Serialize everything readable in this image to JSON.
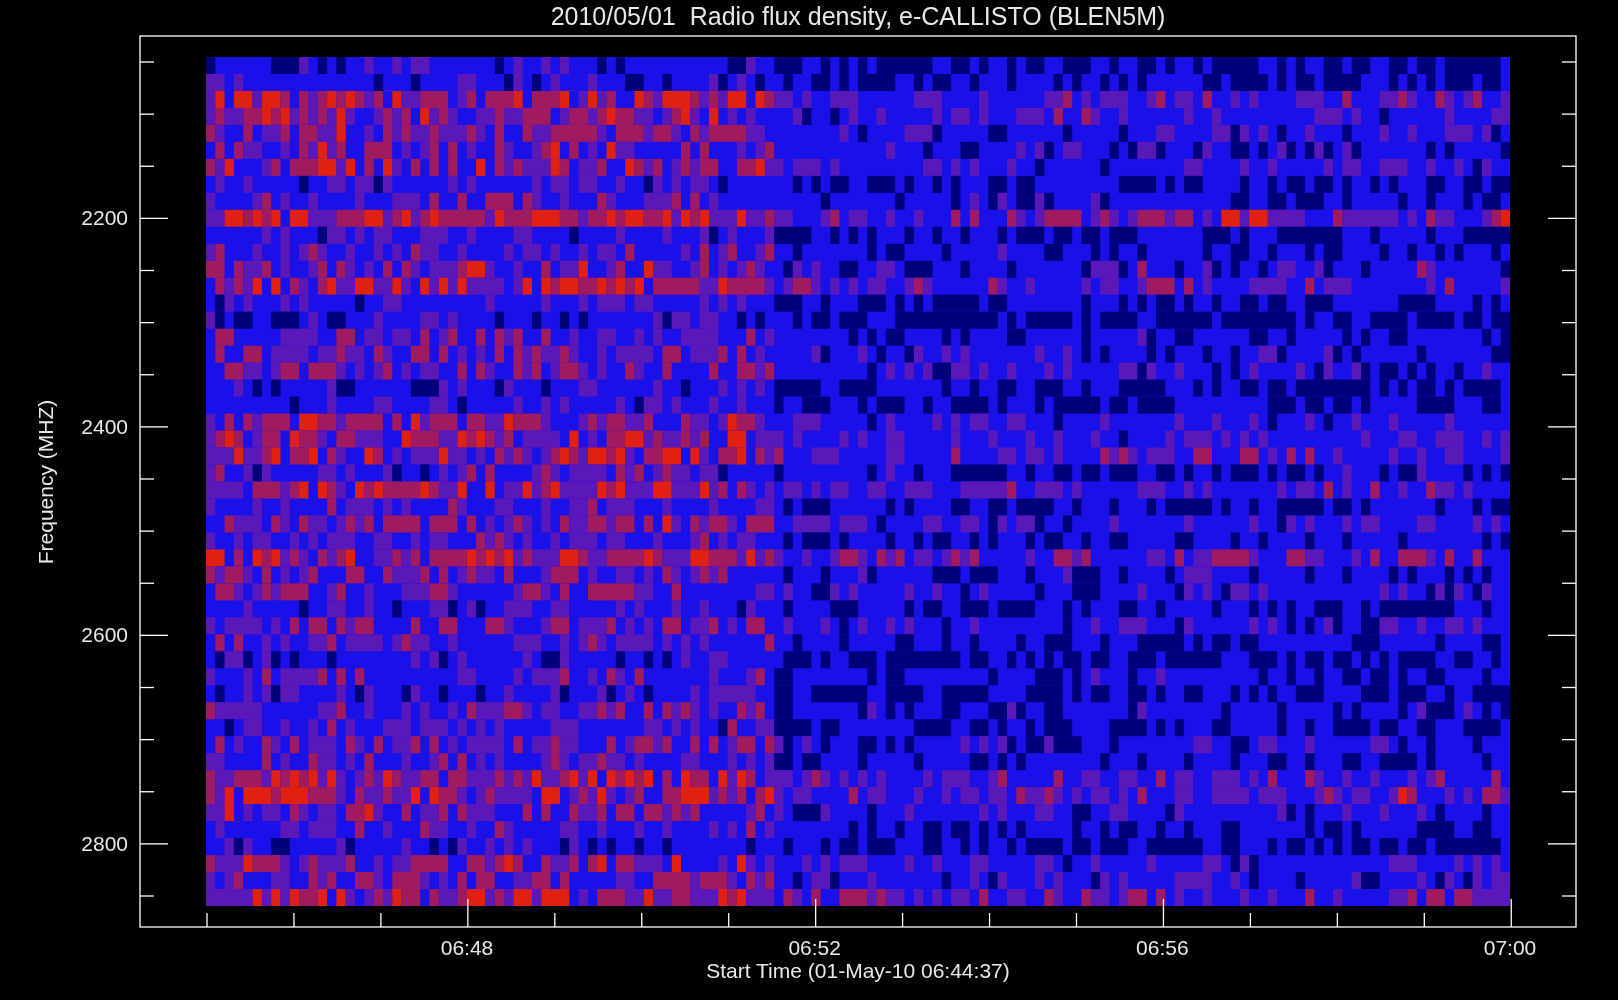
{
  "title": "2010/05/01  Radio flux density, e-CALLISTO (BLEN5M)",
  "y_axis": {
    "label": "Frequency (MHZ)",
    "ticks": [
      "2200",
      "2400",
      "2600",
      "2800"
    ]
  },
  "x_axis": {
    "label": "Start Time (01-May-10 06:44:37)",
    "ticks": [
      "06:48",
      "06:52",
      "06:56",
      "07:00"
    ]
  }
}
